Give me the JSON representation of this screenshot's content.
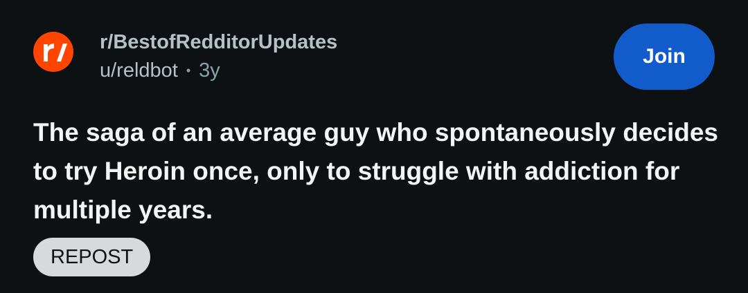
{
  "post": {
    "subreddit": "r/BestofRedditorUpdates",
    "author": "u/reldbot",
    "separator": "•",
    "age": "3y",
    "join_label": "Join",
    "title": "The saga of an average guy who spontaneously decides to try Heroin once, only to struggle with addiction for multiple years.",
    "flair": "REPOST",
    "avatar_icon": "subreddit-logo-icon",
    "avatar_text": "r/"
  },
  "colors": {
    "background": "#0e1113",
    "join_button": "#115bca",
    "avatar": "#ff4500",
    "flair_bg": "#d7dadc",
    "text_primary": "#f2f4f5",
    "text_secondary": "#b7c1c6"
  }
}
